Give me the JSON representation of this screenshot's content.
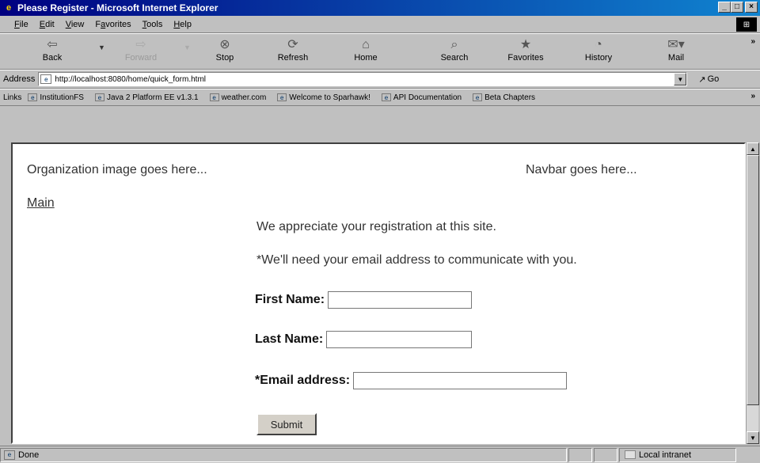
{
  "window": {
    "title": "Please Register - Microsoft Internet Explorer"
  },
  "menu": {
    "items": [
      {
        "label": "File",
        "u": "F"
      },
      {
        "label": "Edit",
        "u": "E"
      },
      {
        "label": "View",
        "u": "V"
      },
      {
        "label": "Favorites",
        "u": "a"
      },
      {
        "label": "Tools",
        "u": "T"
      },
      {
        "label": "Help",
        "u": "H"
      }
    ]
  },
  "toolbar": {
    "back": "Back",
    "forward": "Forward",
    "stop": "Stop",
    "refresh": "Refresh",
    "home": "Home",
    "search": "Search",
    "favorites": "Favorites",
    "history": "History",
    "mail": "Mail"
  },
  "address": {
    "label": "Address",
    "url": "http://localhost:8080/home/quick_form.html",
    "go": "Go"
  },
  "links": {
    "label": "Links",
    "items": [
      "InstitutionFS",
      "Java 2 Platform EE v1.3.1",
      "weather.com",
      "Welcome to Sparhawk!",
      "API Documentation",
      "Beta Chapters"
    ]
  },
  "page": {
    "org_placeholder": "Organization image goes here...",
    "navbar_placeholder": "Navbar goes here...",
    "main_link": "Main",
    "intro1": "We appreciate your registration at this site.",
    "intro2": "*We'll need your email address to communicate with you.",
    "first_name_label": "First Name:",
    "first_name_value": "",
    "last_name_label": "Last Name:",
    "last_name_value": "",
    "email_label": "*Email address:",
    "email_value": "",
    "submit_label": "Submit"
  },
  "status": {
    "text": "Done",
    "zone": "Local intranet"
  }
}
